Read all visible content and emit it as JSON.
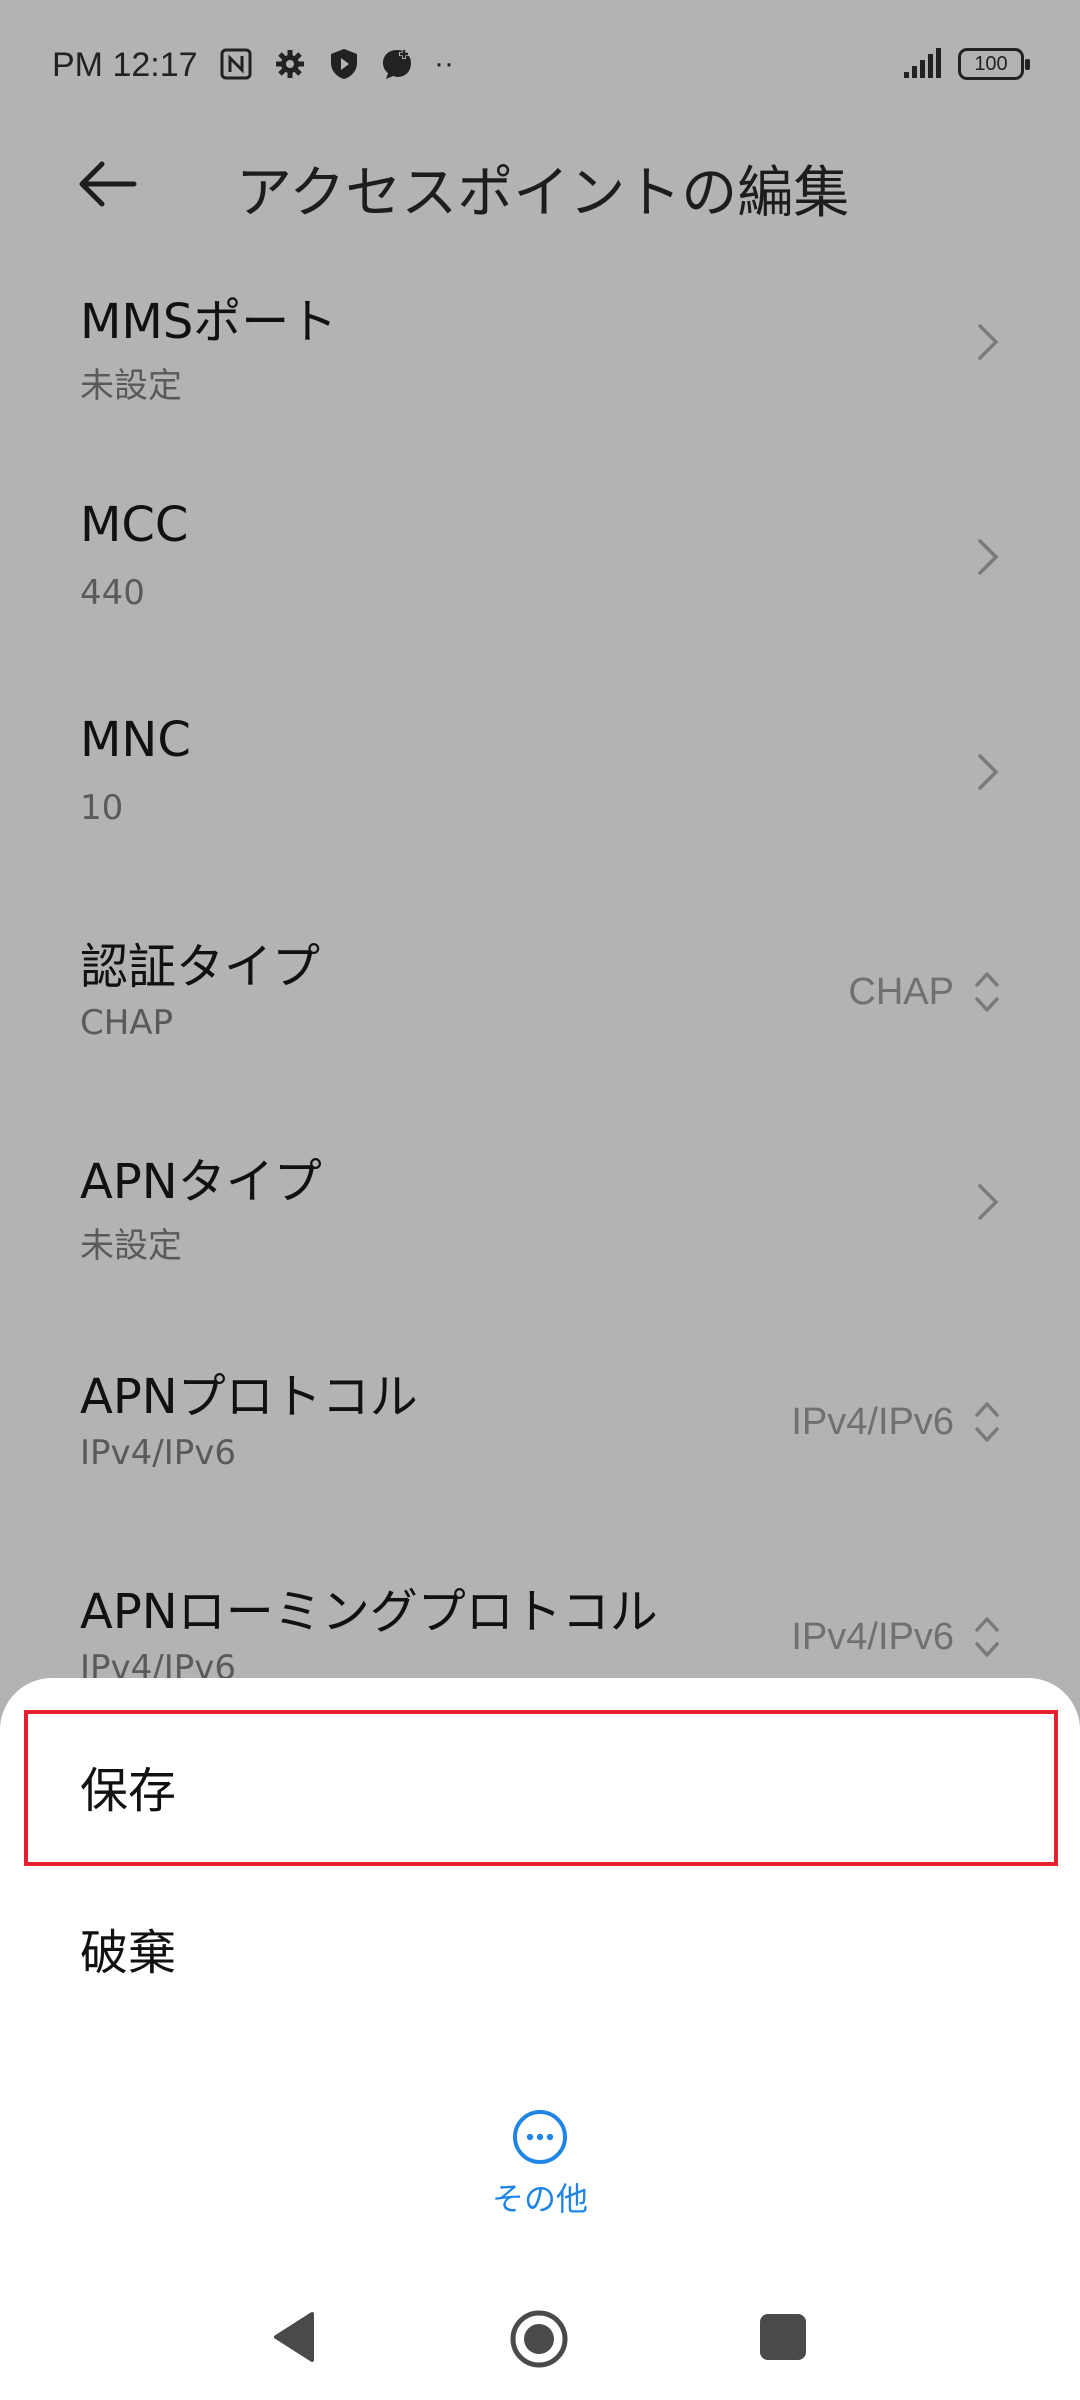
{
  "status_bar": {
    "time": "PM 12:17",
    "battery": "100",
    "more_dots": "··"
  },
  "header": {
    "title": "アクセスポイントの編集"
  },
  "list": [
    {
      "title": "MMSポート",
      "subtitle": "未設定",
      "control": "chevron"
    },
    {
      "title": "MCC",
      "subtitle": "440",
      "control": "chevron"
    },
    {
      "title": "MNC",
      "subtitle": "10",
      "control": "chevron"
    },
    {
      "title": "認証タイプ",
      "subtitle": "CHAP",
      "value": "CHAP",
      "control": "updown"
    },
    {
      "title": "APNタイプ",
      "subtitle": "未設定",
      "control": "chevron"
    },
    {
      "title": "APNプロトコル",
      "subtitle": "IPv4/IPv6",
      "value": "IPv4/IPv6",
      "control": "updown"
    },
    {
      "title": "APNローミングプロトコル",
      "subtitle": "IPv4/IPv6",
      "value": "IPv4/IPv6",
      "control": "updown"
    }
  ],
  "sheet": {
    "save_label": "保存",
    "discard_label": "破棄",
    "more_label": "その他"
  },
  "colors": {
    "accent": "#1f86e6",
    "highlight": "#e5202e",
    "scrim": "#b3b3b3"
  }
}
